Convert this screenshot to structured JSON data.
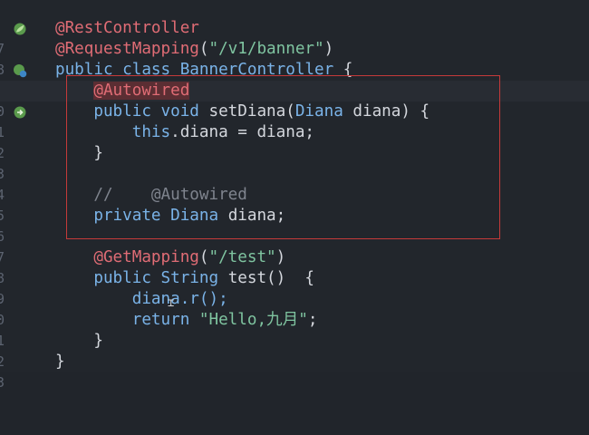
{
  "line_numbers": [
    "7",
    "8",
    "9",
    "0",
    "1",
    "2",
    "3",
    "4",
    "5",
    "6",
    "7",
    "8",
    "9",
    "0",
    "1",
    "2",
    "3"
  ],
  "code": {
    "l1_ann": "@RestController",
    "l2_ann": "@RequestMapping",
    "l2_open": "(",
    "l2_str": "\"/v1/banner\"",
    "l2_close": ")",
    "l3_public": "public",
    "l3_class": "class",
    "l3_name": "BannerController",
    "l3_brace": "{",
    "l4_ann": "@Autowired",
    "l5_public": "public",
    "l5_void": "void",
    "l5_method": "setDiana(",
    "l5_type": "Diana",
    "l5_param": "diana) {",
    "l6_this": "this",
    "l6_rest": ".diana = diana;",
    "l7_brace": "}",
    "l9_comment": "//    @Autowired",
    "l10_private": "private",
    "l10_type": "Diana",
    "l10_field": "diana;",
    "l12_ann": "@GetMapping",
    "l12_open": "(",
    "l12_str": "\"/test\"",
    "l12_close": ")",
    "l13_public": "public",
    "l13_type": "String",
    "l13_rest": "test()  {",
    "l14_call": "diana.r();",
    "l15_return": "return",
    "l15_str": "\"Hello,九月\"",
    "l15_semi": ";",
    "l16_brace": "}",
    "l17_brace": "}"
  },
  "gutter_icons": {
    "l1": "spring-bean-icon",
    "l3": "spring-bean-class-icon",
    "l5": "autowired-injection-icon"
  },
  "colors": {
    "background": "#22262c",
    "annotation": "#e06c75",
    "string": "#7fc4a0",
    "keyword": "#7ab3e8",
    "comment": "#7f848e",
    "highlight_box": "#c53a3a"
  }
}
